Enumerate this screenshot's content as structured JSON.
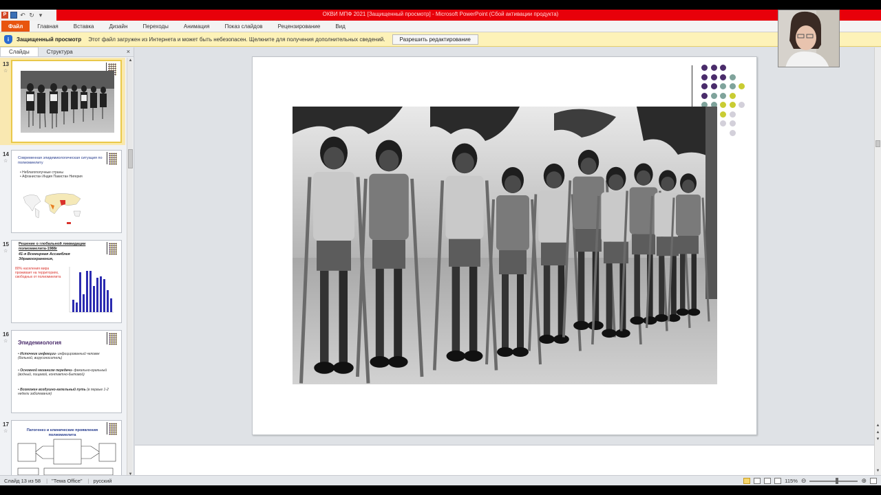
{
  "window": {
    "title": "ОКВИ МПФ 2021 [Защищенный просмотр] - Microsoft PowerPoint (Сбой активации продукта)"
  },
  "ribbon": {
    "tabs": [
      "Файл",
      "Главная",
      "Вставка",
      "Дизайн",
      "Переходы",
      "Анимация",
      "Показ слайдов",
      "Рецензирование",
      "Вид"
    ]
  },
  "protected_view": {
    "label": "Защищенный просмотр",
    "message": "Этот файл загружен из Интернета и может быть небезопасен. Щелкните для получения дополнительных сведений.",
    "button": "Разрешить редактирование"
  },
  "panel": {
    "tabs": [
      "Слайды",
      "Структура"
    ],
    "close": "×"
  },
  "slides": [
    {
      "num": "13",
      "kind": "photo",
      "selected": true
    },
    {
      "num": "14",
      "title": "Современная эпидемиологическая ситуация по полиомиелиту",
      "bullets": [
        "Неблагополучные страны",
        "Афганистан   Индия   Пакистан   Нигерия"
      ]
    },
    {
      "num": "15",
      "title": "Решение о глобальной ликвидации полиомиелита-1988г",
      "subtitle": "41-я Всемирная Ассамблея Здравоохранения,",
      "note": "80% населения мира проживает на территориях, свободных от полиомиелита"
    },
    {
      "num": "16",
      "title": "Эпидемиология",
      "bullets": [
        {
          "head": "Источник инфекции-",
          "text": "инфицированный человек (больной, вирусоноситель)"
        },
        {
          "head": "Основной механизм передачи-",
          "text": "фекально-оральный (водный, пищевой, контактно-бытовой)"
        },
        {
          "head": "Возможен воздушно-капельный путь",
          "text": "(в первые 1-2 недели заболевания)"
        }
      ]
    },
    {
      "num": "17",
      "title": "Патогенез и клинические проявления полиомиелита"
    }
  ],
  "status": {
    "slide": "Слайд 13 из 58",
    "theme": "\"Тема Office\"",
    "language": "русский",
    "zoom": "115%"
  },
  "colors": {
    "titlebar": "#e8000a",
    "file_tab": "#e8550e",
    "protected_bg": "#fdf2b8",
    "dot_purple": "#4a2c6b",
    "dot_teal": "#7fa39b",
    "dot_yellow": "#c9cc33",
    "dot_grey": "#d3d0da"
  },
  "icons": [
    "powerpoint-icon",
    "save-icon",
    "undo-icon",
    "redo-icon",
    "shield-icon",
    "close-icon"
  ]
}
